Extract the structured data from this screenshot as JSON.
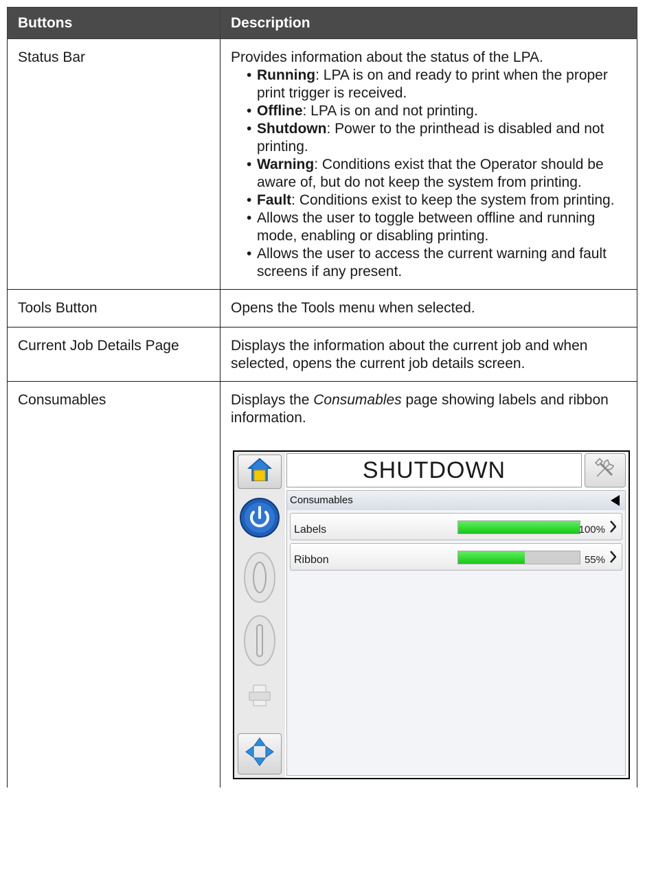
{
  "table": {
    "headers": [
      "Buttons",
      "Description"
    ],
    "rows": [
      {
        "button": "Status Bar",
        "intro": "Provides information about the status of the LPA.",
        "bullets": [
          {
            "term": "Running",
            "text": ": LPA is on and ready to print when the proper print trigger is received."
          },
          {
            "term": "Offline",
            "text": ": LPA is on and not printing."
          },
          {
            "term": "Shutdown",
            "text": ": Power to the printhead is disabled and not printing."
          },
          {
            "term": "Warning",
            "text": ": Conditions exist that the Operator should be aware of, but do not keep the system from printing."
          },
          {
            "term": "Fault",
            "text": ": Conditions exist to keep the system from printing."
          },
          {
            "term": "",
            "text": "Allows the user to toggle between offline and running mode, enabling or disabling printing."
          },
          {
            "term": "",
            "text": "Allows the user to access the current warning and fault screens if any present."
          }
        ]
      },
      {
        "button": "Tools Button",
        "description": "Opens the Tools menu when selected."
      },
      {
        "button": "Current Job Details Page",
        "description": "Displays the information about the current job and when selected, opens the current job details screen."
      },
      {
        "button": "Consumables",
        "desc_before": "Displays the ",
        "desc_italic": "Consumables",
        "desc_after": " page showing labels and ribbon information."
      }
    ]
  },
  "device": {
    "status": "SHUTDOWN",
    "section_title": "Consumables",
    "items": [
      {
        "label": "Labels",
        "percent_text": "100%",
        "level": 1.0
      },
      {
        "label": "Ribbon",
        "percent_text": "55%",
        "level": 0.55
      }
    ],
    "icons": {
      "home": "home-icon",
      "tools": "tools-icon",
      "power": "power-icon",
      "off": "offline-icon",
      "on": "online-icon",
      "print": "printer-icon",
      "navigate": "navigate-arrows-icon"
    },
    "colors": {
      "header_bg": "#4a4a4a",
      "bar_fill": "#17c617",
      "power_blue": "#1f5fb8"
    }
  }
}
